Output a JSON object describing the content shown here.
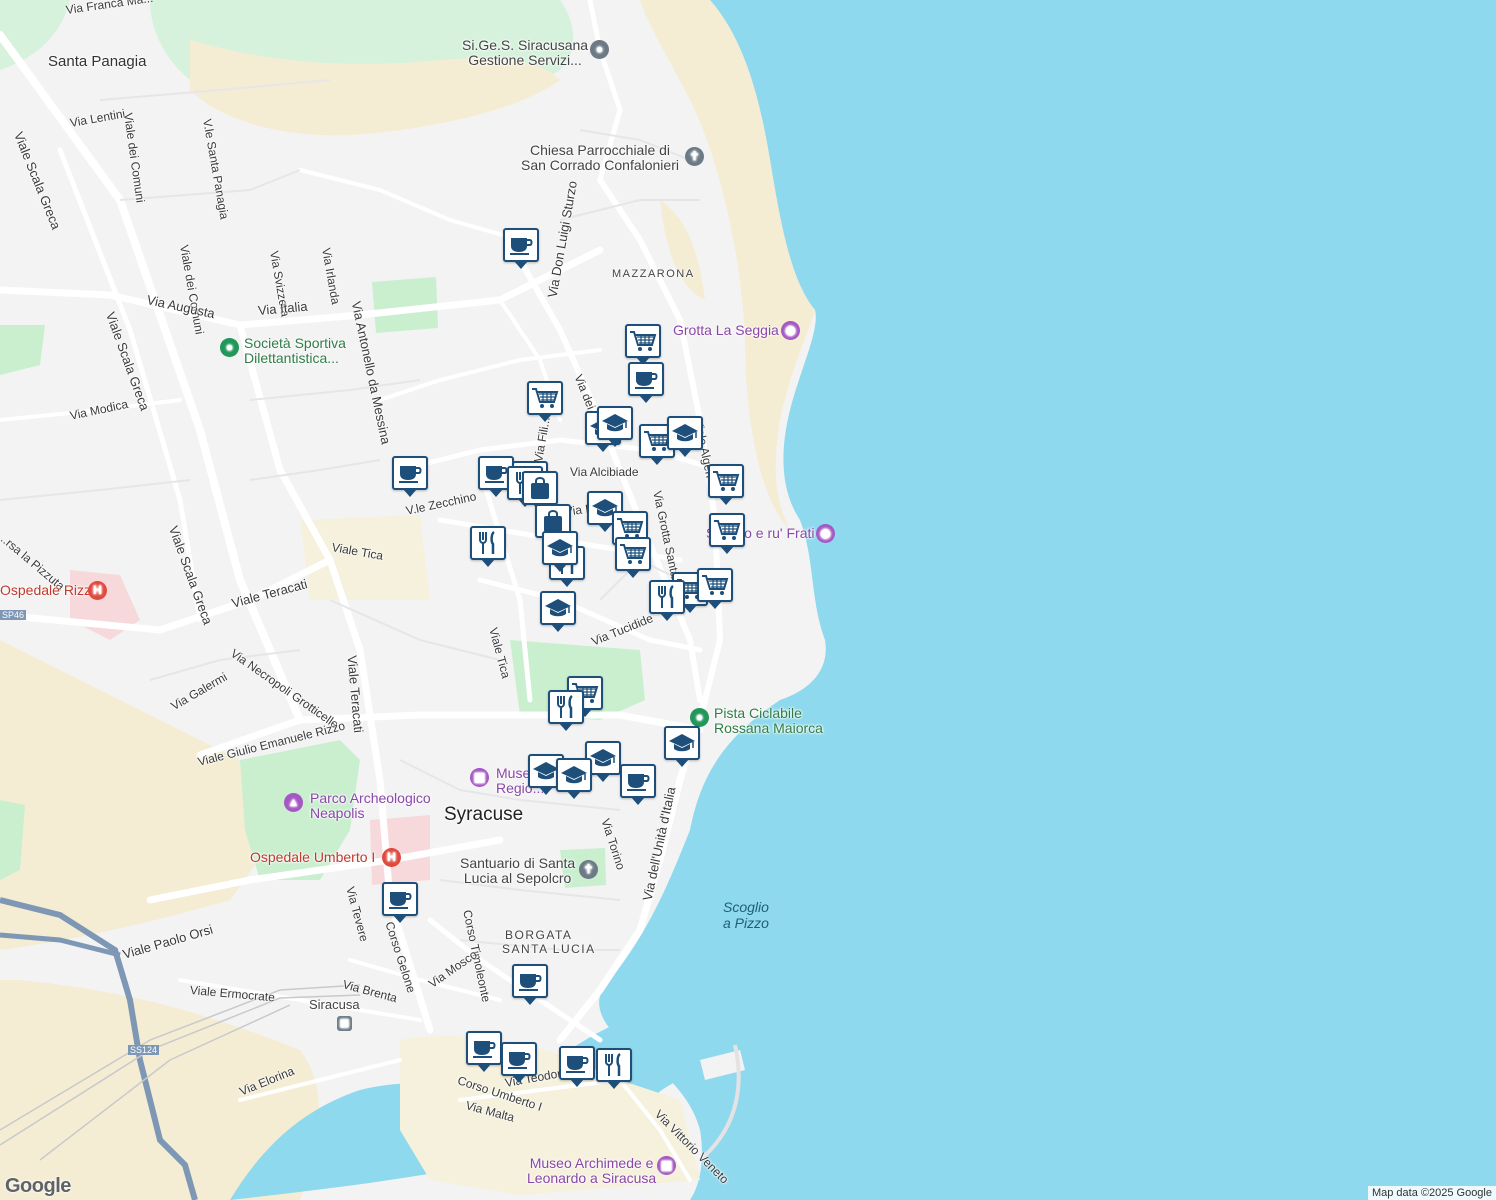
{
  "labels": {
    "area": [
      {
        "id": "santa-panagia",
        "text": "Santa Panagia"
      },
      {
        "id": "syracuse",
        "text": "Syracuse"
      },
      {
        "id": "mazzarona",
        "text": "MAZZARONA"
      },
      {
        "id": "borgata-1",
        "text": "BORGATA"
      },
      {
        "id": "borgata-2",
        "text": "SANTA LUCIA"
      }
    ],
    "sea": [
      {
        "id": "scoglio",
        "text": "Scoglio"
      },
      {
        "id": "scoglio-2",
        "text": "a Pizzo"
      }
    ],
    "streets": [
      {
        "id": "s1",
        "text": "Via Franca Ma..."
      },
      {
        "id": "s2",
        "text": "Via Lentini"
      },
      {
        "id": "s3",
        "text": "Viale Scala Greca"
      },
      {
        "id": "s4",
        "text": "Viale dei Comuni"
      },
      {
        "id": "s5",
        "text": "V.le Santa Panagia"
      },
      {
        "id": "s6",
        "text": "Viale dei Comuni"
      },
      {
        "id": "s7",
        "text": "Via Svizzera"
      },
      {
        "id": "s8",
        "text": "Via Irlanda"
      },
      {
        "id": "s9",
        "text": "Via Italia"
      },
      {
        "id": "s10",
        "text": "Via Augusta"
      },
      {
        "id": "s11",
        "text": "Viale Scala Greca"
      },
      {
        "id": "s12",
        "text": "Via Modica"
      },
      {
        "id": "s13",
        "text": "Via Antonello da Messina"
      },
      {
        "id": "s14",
        "text": "Viale Scala Greca"
      },
      {
        "id": "s15",
        "text": "V.le Zecchino"
      },
      {
        "id": "s16",
        "text": "Viale Tica"
      },
      {
        "id": "s17",
        "text": "Viale Teracati"
      },
      {
        "id": "s18",
        "text": "Viale Teracati"
      },
      {
        "id": "s19",
        "text": "Via Necropoli Grotticelle"
      },
      {
        "id": "s20",
        "text": "Via Galermi"
      },
      {
        "id": "s21",
        "text": "Viale Giulio Emanuele Rizzo"
      },
      {
        "id": "s22",
        "text": "Viale Tica"
      },
      {
        "id": "s23",
        "text": "Via Don Luigi Sturzo"
      },
      {
        "id": "s24",
        "text": "Via Tucidide"
      },
      {
        "id": "s25",
        "text": "Via Grotta Santa"
      },
      {
        "id": "s26",
        "text": "Viale Algeri"
      },
      {
        "id": "s27",
        "text": "Via dell'Unità d'Italia"
      },
      {
        "id": "s28",
        "text": "Via Torino"
      },
      {
        "id": "s29",
        "text": "Viale Paolo Orsi"
      },
      {
        "id": "s30",
        "text": "Via Tevere"
      },
      {
        "id": "s31",
        "text": "Corso Gelone"
      },
      {
        "id": "s32",
        "text": "Corso Timoleonte"
      },
      {
        "id": "s33",
        "text": "Via Mosco"
      },
      {
        "id": "s34",
        "text": "Via Brenta"
      },
      {
        "id": "s35",
        "text": "Viale Ermocrate"
      },
      {
        "id": "s36",
        "text": "Via Elorina"
      },
      {
        "id": "s37",
        "text": "Corso Umberto I"
      },
      {
        "id": "s38",
        "text": "Via Malta"
      },
      {
        "id": "s39",
        "text": "Via Vittorio Veneto"
      },
      {
        "id": "s40",
        "text": "SS124"
      },
      {
        "id": "s41",
        "text": "SP46"
      },
      {
        "id": "s42",
        "text": "Via dei Ser..."
      },
      {
        "id": "s43",
        "text": "Via Fili..."
      },
      {
        "id": "s44",
        "text": "Via Alcibiade"
      },
      {
        "id": "s45",
        "text": "Via Filisto"
      },
      {
        "id": "s46",
        "text": "...rsa la Pizzuta"
      },
      {
        "id": "s47",
        "text": "Via Teodoro"
      }
    ]
  },
  "pois": [
    {
      "id": "p1",
      "lines": [
        "Si.Ge.S. Siracusana",
        "Gestione Servizi..."
      ],
      "color": "gray",
      "icon": "pin-icon",
      "glyph": "●"
    },
    {
      "id": "p2",
      "lines": [
        "Chiesa Parrocchiale di",
        "San Corrado Confalonieri"
      ],
      "color": "gray",
      "icon": "church-icon",
      "glyph": "✝"
    },
    {
      "id": "p3",
      "lines": [
        "Grotta La Seggia"
      ],
      "color": "purple",
      "icon": "camera-icon",
      "glyph": "◉"
    },
    {
      "id": "p4",
      "lines": [
        "Società Sportiva",
        "Dilettantistica..."
      ],
      "color": "green",
      "icon": "park-icon",
      "glyph": "●"
    },
    {
      "id": "p5",
      "lines": [
        "Scoglio e ru' Frati"
      ],
      "color": "purple",
      "icon": "camera-icon",
      "glyph": "◉"
    },
    {
      "id": "p6",
      "lines": [
        "Ospedale Rizza"
      ],
      "color": "red",
      "icon": "hospital-icon",
      "glyph": "H"
    },
    {
      "id": "p7",
      "lines": [
        "Pista Ciclabile",
        "Rossana Maiorca"
      ],
      "color": "green",
      "icon": "park-icon",
      "glyph": "●"
    },
    {
      "id": "p8",
      "lines": [
        "Museo",
        "Regio..."
      ],
      "color": "purple",
      "icon": "museum-icon",
      "glyph": "▦"
    },
    {
      "id": "p9",
      "lines": [
        "Parco Archeologico",
        "Neapolis"
      ],
      "color": "purple",
      "icon": "monument-icon",
      "glyph": "▲"
    },
    {
      "id": "p10",
      "lines": [
        "Ospedale Umberto I"
      ],
      "color": "red",
      "icon": "hospital-icon",
      "glyph": "H"
    },
    {
      "id": "p11",
      "lines": [
        "Santuario di Santa",
        "Lucia al Sepolcro"
      ],
      "color": "gray",
      "icon": "church-icon",
      "glyph": "✝"
    },
    {
      "id": "p12",
      "lines": [
        "Siracusa"
      ],
      "color": "gray",
      "icon": "train-icon",
      "glyph": "▣"
    },
    {
      "id": "p13",
      "lines": [
        "Museo Archimede e",
        "Leonardo a Siracusa"
      ],
      "color": "purple",
      "icon": "museum-icon",
      "glyph": "▦"
    }
  ],
  "markers": [
    {
      "type": "cafe"
    },
    {
      "type": "grocery"
    },
    {
      "type": "cafe"
    },
    {
      "type": "grocery"
    },
    {
      "type": "school"
    },
    {
      "type": "school"
    },
    {
      "type": "grocery"
    },
    {
      "type": "school"
    },
    {
      "type": "grocery"
    },
    {
      "type": "cafe"
    },
    {
      "type": "cafe"
    },
    {
      "type": "school"
    },
    {
      "type": "restaurant"
    },
    {
      "type": "shopping"
    },
    {
      "type": "shopping"
    },
    {
      "type": "restaurant"
    },
    {
      "type": "school"
    },
    {
      "type": "grocery"
    },
    {
      "type": "grocery"
    },
    {
      "type": "restaurant"
    },
    {
      "type": "grocery"
    },
    {
      "type": "grocery"
    },
    {
      "type": "restaurant"
    },
    {
      "type": "school"
    },
    {
      "type": "grocery"
    },
    {
      "type": "restaurant"
    },
    {
      "type": "school"
    },
    {
      "type": "school"
    },
    {
      "type": "school"
    },
    {
      "type": "school"
    },
    {
      "type": "cafe"
    },
    {
      "type": "cafe"
    },
    {
      "type": "cafe"
    },
    {
      "type": "cafe"
    },
    {
      "type": "cafe"
    },
    {
      "type": "cafe"
    },
    {
      "type": "restaurant"
    },
    {
      "type": "grocery"
    },
    {
      "type": "school"
    }
  ],
  "colors": {
    "sea": "#8fd9ee",
    "land": "#f3f3f4",
    "road": "#ffffff",
    "park": "#c9efcf",
    "sand": "#f4edd3",
    "marker_border": "#1d4f7a",
    "highway": "#7d97b5"
  },
  "branding": {
    "logo": "Google",
    "attribution": "Map data ©2025 Google"
  }
}
